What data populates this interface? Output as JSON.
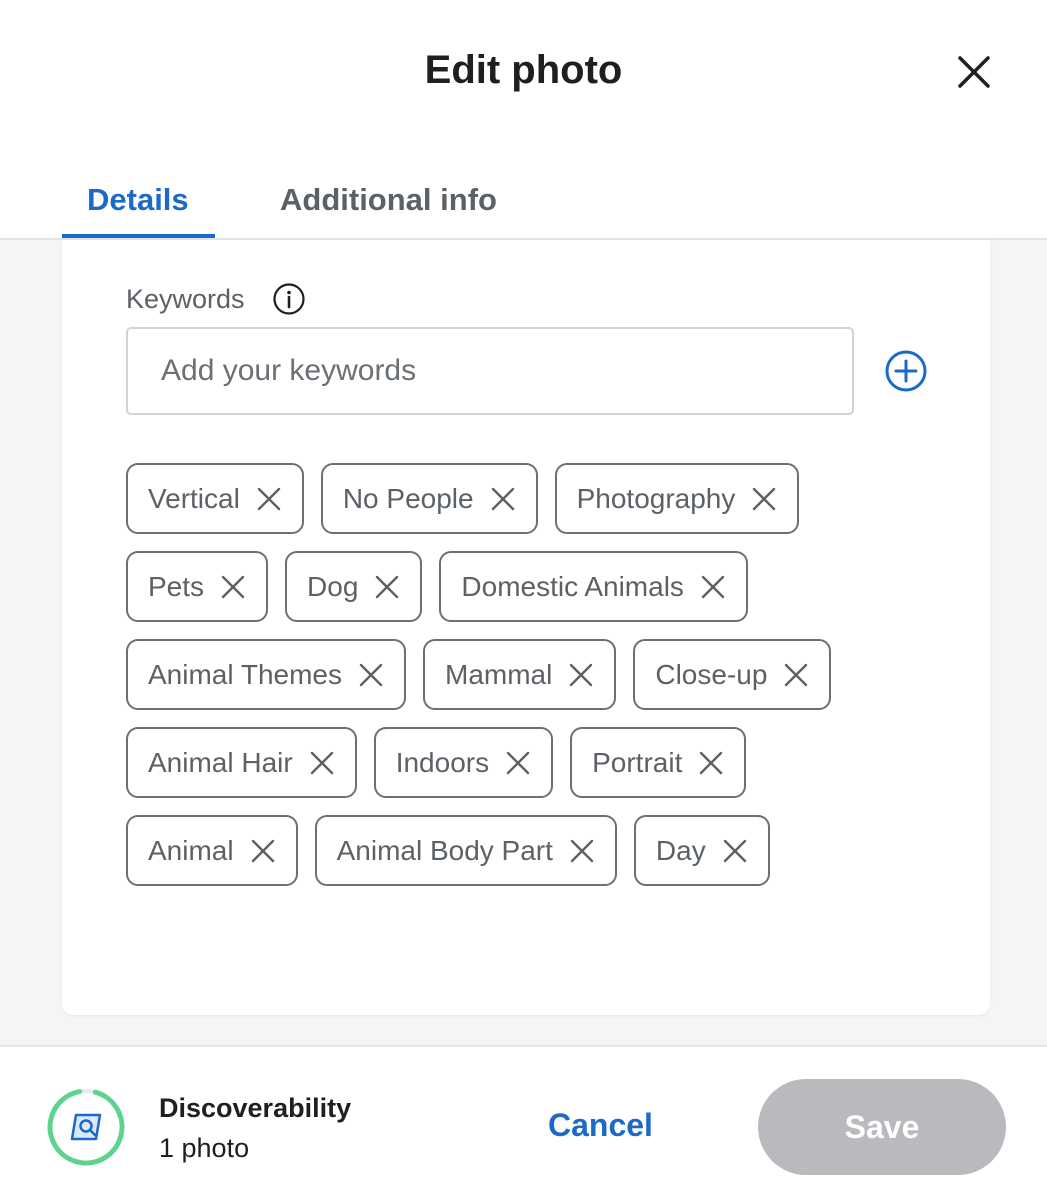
{
  "header": {
    "title": "Edit photo",
    "tabs": [
      {
        "label": "Details",
        "active": true
      },
      {
        "label": "Additional info",
        "active": false
      }
    ]
  },
  "keywords": {
    "label": "Keywords",
    "placeholder": "Add your keywords",
    "chips": [
      "Vertical",
      "No People",
      "Photography",
      "Pets",
      "Dog",
      "Domestic Animals",
      "Animal Themes",
      "Mammal",
      "Close-up",
      "Animal Hair",
      "Indoors",
      "Portrait",
      "Animal",
      "Animal Body Part",
      "Day"
    ]
  },
  "footer": {
    "discoverability_title": "Discoverability",
    "photo_count": "1 photo",
    "cancel_label": "Cancel",
    "save_label": "Save"
  },
  "colors": {
    "accent": "#1b6ac9",
    "progress": "#5fd38d",
    "save_disabled": "#b8babd"
  },
  "icons": [
    "close-icon",
    "info-icon",
    "add-circle-icon",
    "chip-remove-icon",
    "discoverability-icon"
  ]
}
